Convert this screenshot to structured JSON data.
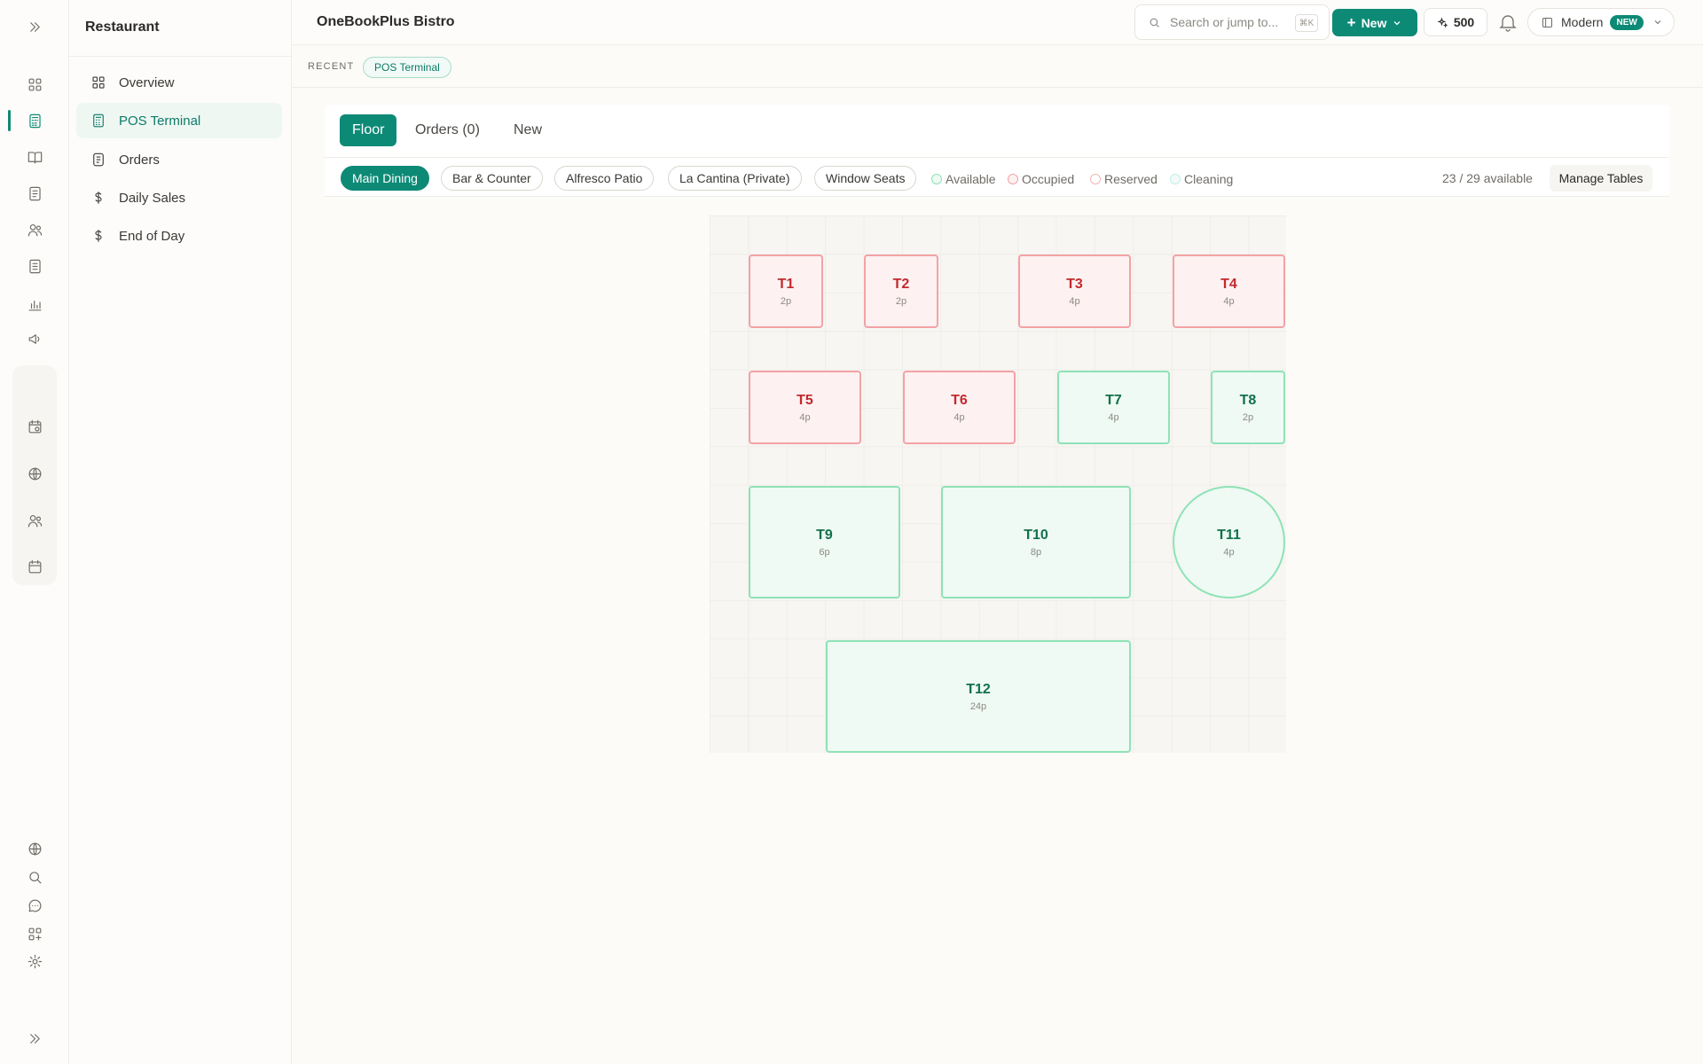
{
  "sidebar": {
    "title": "Restaurant",
    "items": [
      {
        "label": "Overview"
      },
      {
        "label": "POS Terminal"
      },
      {
        "label": "Orders"
      },
      {
        "label": "Daily Sales"
      },
      {
        "label": "End of Day"
      }
    ]
  },
  "header": {
    "title": "OneBookPlus Bistro",
    "search_placeholder": "Search or jump to...",
    "search_shortcut": "⌘K",
    "new_label": "New",
    "credits": "500",
    "theme_label": "Modern",
    "theme_badge": "NEW"
  },
  "recent": {
    "label": "RECENT",
    "chip": "POS Terminal"
  },
  "tabs": [
    {
      "label": "Floor"
    },
    {
      "label": "Orders (0)"
    },
    {
      "label": "New"
    }
  ],
  "areas": [
    {
      "label": "Main Dining"
    },
    {
      "label": "Bar & Counter"
    },
    {
      "label": "Alfresco Patio"
    },
    {
      "label": "La Cantina (Private)"
    },
    {
      "label": "Window Seats"
    }
  ],
  "legend": [
    {
      "label": "Available",
      "color": "#8fe2b6"
    },
    {
      "label": "Occupied",
      "color": "#f3a2a6"
    },
    {
      "label": "Reserved",
      "color": "#f3b4b4"
    },
    {
      "label": "Cleaning",
      "color": "#bfeee5"
    }
  ],
  "availability": "23 / 29 available",
  "manage_label": "Manage Tables",
  "colors": {
    "accent": "#0d8a76",
    "occupied": "#c12a2e",
    "available": "#12704d"
  },
  "tables": [
    {
      "name": "T1",
      "capacity": "2p",
      "status": "occupied"
    },
    {
      "name": "T2",
      "capacity": "2p",
      "status": "occupied"
    },
    {
      "name": "T3",
      "capacity": "4p",
      "status": "occupied"
    },
    {
      "name": "T4",
      "capacity": "4p",
      "status": "occupied"
    },
    {
      "name": "T5",
      "capacity": "4p",
      "status": "occupied"
    },
    {
      "name": "T6",
      "capacity": "4p",
      "status": "occupied"
    },
    {
      "name": "T7",
      "capacity": "4p",
      "status": "available"
    },
    {
      "name": "T8",
      "capacity": "2p",
      "status": "available"
    },
    {
      "name": "T9",
      "capacity": "6p",
      "status": "available"
    },
    {
      "name": "T10",
      "capacity": "8p",
      "status": "available"
    },
    {
      "name": "T11",
      "capacity": "4p",
      "status": "available"
    },
    {
      "name": "T12",
      "capacity": "24p",
      "status": "available"
    }
  ]
}
